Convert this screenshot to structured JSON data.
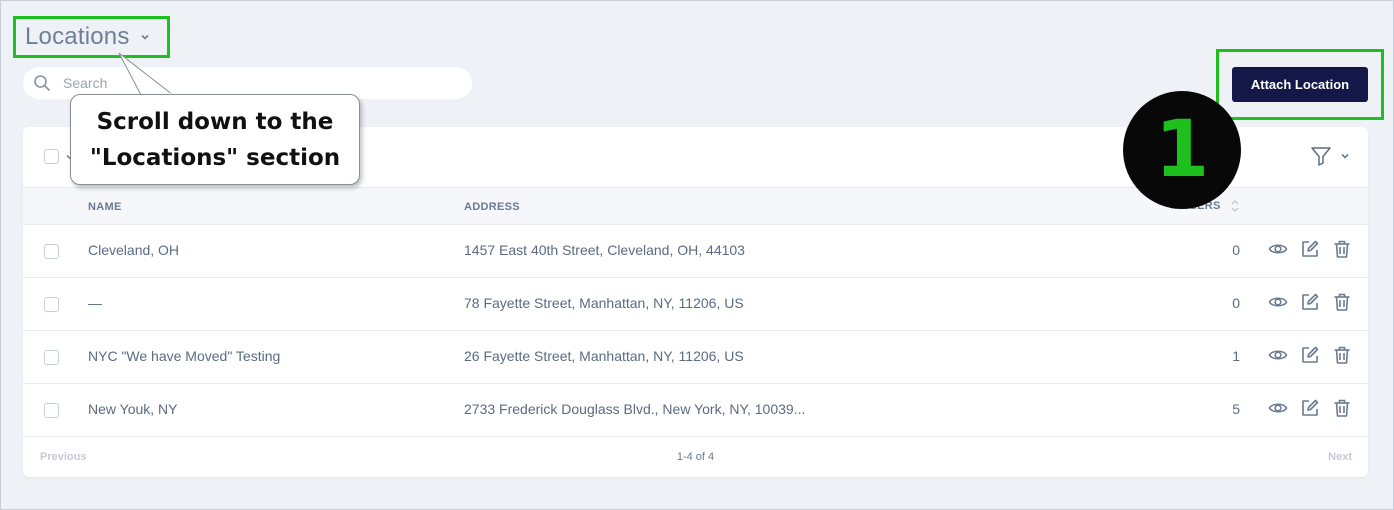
{
  "header": {
    "title": "Locations"
  },
  "search": {
    "placeholder": "Search"
  },
  "toolbar": {
    "attach_label": "Attach Location"
  },
  "table": {
    "columns": {
      "name": "NAME",
      "address": "ADDRESS",
      "users": "# USERS"
    },
    "rows": [
      {
        "name": "Cleveland, OH",
        "address": "1457 East 40th Street, Cleveland, OH, 44103",
        "users": "0"
      },
      {
        "name": "—",
        "address": "78 Fayette Street, Manhattan, NY, 11206, US",
        "users": "0"
      },
      {
        "name": "NYC \"We have Moved\" Testing",
        "address": "26 Fayette Street, Manhattan, NY, 11206, US",
        "users": "1"
      },
      {
        "name": "New Youk, NY",
        "address": "2733 Frederick Douglass Blvd., New York, NY, 10039...",
        "users": "5"
      }
    ]
  },
  "pagination": {
    "previous": "Previous",
    "range": "1-4 of 4",
    "next": "Next"
  },
  "annotation": {
    "callout_line1": "Scroll down to the",
    "callout_line2": "\"Locations\" section",
    "step_number": "1",
    "highlight_color": "#1ec01e"
  },
  "icons": {
    "search": "search-icon",
    "chevron": "chevron-down-icon",
    "filter": "filter-icon",
    "sort": "sort-icon",
    "view": "eye-icon",
    "edit": "edit-icon",
    "delete": "trash-icon"
  },
  "colors": {
    "primary_button": "#141848",
    "background": "#eef1f6"
  }
}
